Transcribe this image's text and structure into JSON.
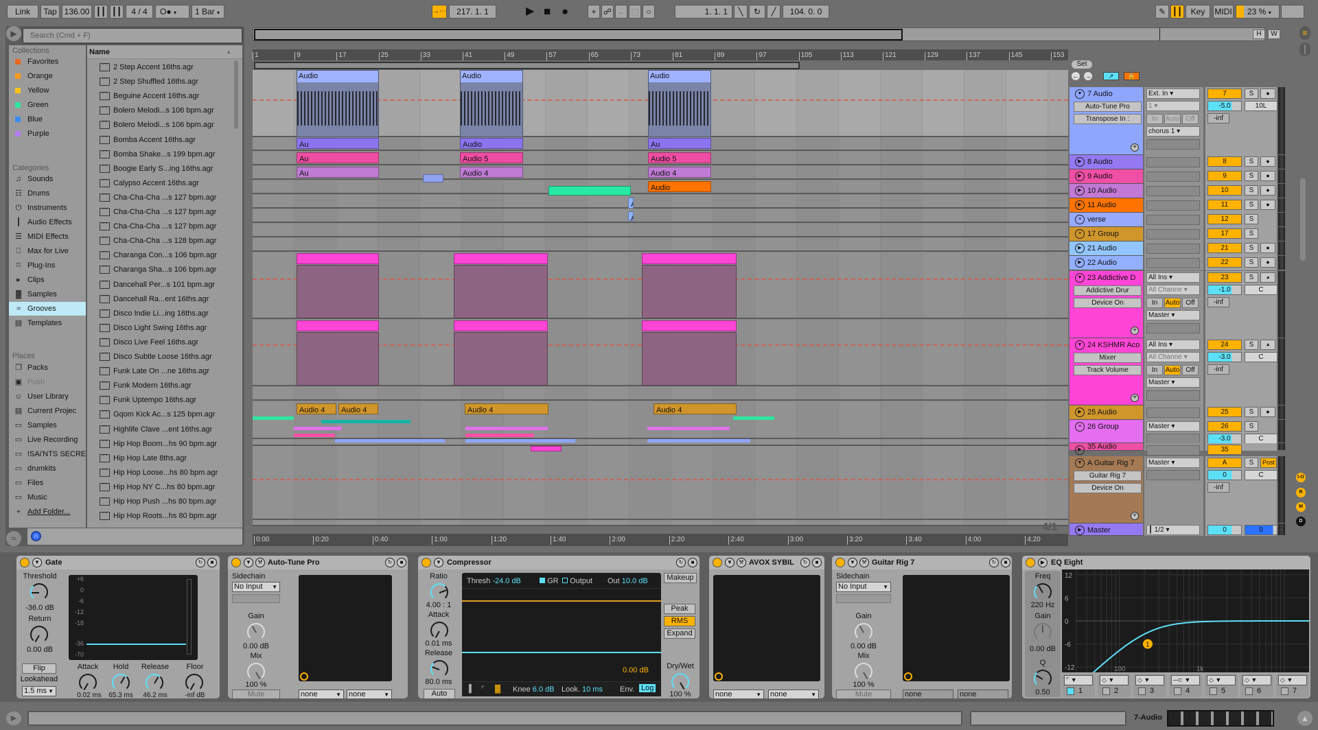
{
  "toolbar": {
    "link": "Link",
    "tap": "Tap",
    "tempo": "136.00",
    "time_sig": "4 / 4",
    "metronome": "O●",
    "quantize": "1 Bar",
    "follow_icon": "→⋯",
    "position": "217.  1.  1",
    "loop_start": "1.  1.  1",
    "loop_length": "104.  0.  0",
    "key": "Key",
    "midi": "MIDI",
    "cpu": "23 %"
  },
  "browser": {
    "search_placeholder": "Search (Cmd + F)",
    "collections_title": "Collections",
    "collections": [
      {
        "label": "Favorites",
        "color": "#e8681e"
      },
      {
        "label": "Orange",
        "color": "#ff9a1c"
      },
      {
        "label": "Yellow",
        "color": "#ffc21a"
      },
      {
        "label": "Green",
        "color": "#2fe6a0"
      },
      {
        "label": "Blue",
        "color": "#3b8cf5"
      },
      {
        "label": "Purple",
        "color": "#b47cf0"
      }
    ],
    "categories_title": "Categories",
    "categories": [
      {
        "label": "Sounds",
        "icon": "♫"
      },
      {
        "label": "Drums",
        "icon": "☷"
      },
      {
        "label": "Instruments",
        "icon": "⏻"
      },
      {
        "label": "Audio Effects",
        "icon": "┃"
      },
      {
        "label": "MIDI Effects",
        "icon": "☰"
      },
      {
        "label": "Max for Live",
        "icon": "⎕"
      },
      {
        "label": "Plug-Ins",
        "icon": "⌑"
      },
      {
        "label": "Clips",
        "icon": "▸"
      },
      {
        "label": "Samples",
        "icon": "▓"
      },
      {
        "label": "Grooves",
        "icon": "≈",
        "selected": true
      },
      {
        "label": "Templates",
        "icon": "▤"
      }
    ],
    "places_title": "Places",
    "places": [
      {
        "label": "Packs",
        "icon": "❐"
      },
      {
        "label": "Push",
        "icon": "▣",
        "disabled": true
      },
      {
        "label": "User Library",
        "icon": "☺"
      },
      {
        "label": "Current Projec",
        "icon": "▤"
      },
      {
        "label": "Samples",
        "icon": "▭"
      },
      {
        "label": "Live Recording",
        "icon": "▭"
      },
      {
        "label": "!SAi'NTS SECRE",
        "icon": "▭"
      },
      {
        "label": "drumkits",
        "icon": "▭"
      },
      {
        "label": "Files",
        "icon": "▭"
      },
      {
        "label": "Music",
        "icon": "▭"
      },
      {
        "label": "Add Folder...",
        "icon": "+"
      }
    ],
    "name_header": "Name",
    "files": [
      "2 Step Accent 16ths.agr",
      "2 Step Shuffled 16ths.agr",
      "Beguine Accent 16ths.agr",
      "Bolero Melodi...s 106 bpm.agr",
      "Bolero Melodi...s 106 bpm.agr",
      "Bomba Accent 16ths.agr",
      "Bomba Shake...s 199 bpm.agr",
      "Boogie Early S...ing 16ths.agr",
      "Calypso Accent 16ths.agr",
      "Cha-Cha-Cha ...s 127 bpm.agr",
      "Cha-Cha-Cha ...s 127 bpm.agr",
      "Cha-Cha-Cha ...s 127 bpm.agr",
      "Cha-Cha-Cha ...s 128 bpm.agr",
      "Charanga Con...s 106 bpm.agr",
      "Charanga Sha...s 106 bpm.agr",
      "Dancehall Per...s 101 bpm.agr",
      "Dancehall Ra...ent 16ths.agr",
      "Disco Indie Li...ing 16ths.agr",
      "Disco Light Swing 16ths.agr",
      "Disco Live Feel 16ths.agr",
      "Disco Subtle Loose 16ths.agr",
      "Funk Late On ...ne 16ths.agr",
      "Funk Modern 16ths.agr",
      "Funk Uptempo 16ths.agr",
      "Gqom Kick Ac...s 125 bpm.agr",
      "Highlife Clave ...ent 16ths.agr",
      "Hip Hop Boom...hs 90 bpm.agr",
      "Hip Hop Late 8ths.agr",
      "Hip Hop Loose...hs 80 bpm.agr",
      "Hip Hop NY C...hs 80 bpm.agr",
      "Hip Hop Push ...hs 80 bpm.agr",
      "Hip Hop Roots...hs 80 bpm.agr"
    ]
  },
  "arrangement": {
    "bar_ticks": [
      "1",
      "9",
      "17",
      "25",
      "33",
      "41",
      "49",
      "57",
      "65",
      "73",
      "81",
      "89",
      "97",
      "105",
      "113",
      "121",
      "129",
      "137",
      "145",
      "153"
    ],
    "time_ticks": [
      "0:00",
      "0:20",
      "0:40",
      "1:00",
      "1:20",
      "1:40",
      "2:00",
      "2:20",
      "2:40",
      "3:00",
      "3:20",
      "3:40",
      "4:00",
      "4:20"
    ],
    "zoom_readout": "4/1",
    "overview_h": "H",
    "overview_w": "W",
    "clip_labels": {
      "audio": "Audio",
      "audio5": "Audio 5",
      "audio4": "Audio 4",
      "au": "Au",
      "a": "A"
    }
  },
  "tracks": {
    "set_label": "Set",
    "list": [
      {
        "name": "7 Audio",
        "color": "#8fa6ff",
        "num": "7",
        "input": "Ext. In",
        "channel": "1",
        "output": "chorus 1",
        "device": "Auto-Tune Pro",
        "param": "Transpose In :",
        "vol": "-5.0",
        "pan": "10L",
        "inf": "-inf",
        "monitor": [
          "In",
          "Auto",
          "Off"
        ]
      },
      {
        "name": "8 Audio",
        "color": "#9579f2",
        "num": "8"
      },
      {
        "name": "9 Audio",
        "color": "#f04fa6",
        "num": "9"
      },
      {
        "name": "10 Audio",
        "color": "#c279d6",
        "num": "10"
      },
      {
        "name": "11 Audio",
        "color": "#ff7300",
        "num": "11"
      },
      {
        "name": "verse",
        "color": "#98aaff",
        "num": "12"
      },
      {
        "name": "17 Group",
        "color": "#d0962b",
        "num": "17"
      },
      {
        "name": "21 Audio",
        "color": "#93c6ff",
        "num": "21"
      },
      {
        "name": "22 Audio",
        "color": "#93b0ff",
        "num": "22"
      },
      {
        "name": "23 Addictive D",
        "color": "#ff45d6",
        "num": "23",
        "input": "All Ins",
        "channel": "All Channe",
        "output": "Master",
        "device": "Addictive Drur",
        "param": "Device On",
        "vol": "-1.0",
        "pan": "C",
        "inf": "-inf",
        "monitor": [
          "In",
          "Auto",
          "Off"
        ]
      },
      {
        "name": "24 KSHMR Aco",
        "color": "#ff45d6",
        "num": "24",
        "input": "All Ins",
        "channel": "All Channe",
        "output": "Master",
        "device": "Mixer",
        "param": "Track Volume",
        "vol": "-3.0",
        "pan": "C",
        "inf": "-inf",
        "monitor": [
          "In",
          "Auto",
          "Off"
        ]
      },
      {
        "name": "25 Audio",
        "color": "#d0962b",
        "num": "25"
      },
      {
        "name": "26 Group",
        "color": "#e46df0",
        "num": "26",
        "output": "Master",
        "vol": "-3.0",
        "pan": "C"
      },
      {
        "name": "35 Audio",
        "color": "#f04fa6",
        "num": "35"
      },
      {
        "name": "A Guitar Rig 7",
        "color": "#a47a55",
        "num": "A",
        "output": "Master",
        "device": "Guitar Rig 7",
        "param": "Device On",
        "vol": "0",
        "pan": "C",
        "inf": "-inf",
        "post": "Post"
      },
      {
        "name": "Master",
        "color": "#9579f2",
        "num": "0",
        "output": "1/2",
        "vol": "0"
      }
    ],
    "solo": "S",
    "right_icons": [
      "I-O",
      "R",
      "M",
      "D"
    ]
  },
  "devices": {
    "gate": {
      "title": "Gate",
      "threshold_label": "Threshold",
      "threshold": "-36.0 dB",
      "return_label": "Return",
      "return": "0.00 dB",
      "flip": "Flip",
      "lookahead_label": "Lookahead",
      "lookahead": "1.5 ms",
      "attack_label": "Attack",
      "attack": "0.02 ms",
      "hold_label": "Hold",
      "hold": "65.3 ms",
      "release_label": "Release",
      "release": "46.2 ms",
      "floor_label": "Floor",
      "floor": "-inf dB",
      "scale": [
        "+6",
        "0",
        "-6",
        "-12",
        "-18",
        "-36",
        "-70"
      ]
    },
    "autotune": {
      "title": "Auto-Tune Pro",
      "sidechain": "Sidechain",
      "sidechain_input": "No Input",
      "gain_label": "Gain",
      "gain": "0.00 dB",
      "mix_label": "Mix",
      "mix": "100 %",
      "mute": "Mute",
      "macro1": "none",
      "macro2": "none"
    },
    "compressor": {
      "title": "Compressor",
      "ratio_label": "Ratio",
      "ratio": "4.00 : 1",
      "attack_label": "Attack",
      "attack": "0.01 ms",
      "release_label": "Release",
      "release": "80.0 ms",
      "auto": "Auto",
      "thresh_label": "Thresh",
      "thresh": "-24.0 dB",
      "gr": "GR",
      "output": "Output",
      "out_label": "Out",
      "out": "10.0 dB",
      "readout": "0.00 dB",
      "knee_label": "Knee",
      "knee": "6.0 dB",
      "look_label": "Look.",
      "look": "10 ms",
      "env_label": "Env.",
      "env": "Log",
      "makeup": "Makeup",
      "peak": "Peak",
      "rms": "RMS",
      "expand": "Expand",
      "drywet_label": "Dry/Wet",
      "drywet": "100 %"
    },
    "avox": {
      "title": "AVOX SYBIL",
      "macro1": "none",
      "macro2": "none"
    },
    "guitarrig": {
      "title": "Guitar Rig 7",
      "sidechain": "Sidechain",
      "sidechain_input": "No Input",
      "gain_label": "Gain",
      "gain": "0.00 dB",
      "mix_label": "Mix",
      "mix": "100 %",
      "mute": "Mute",
      "macro1": "none",
      "macro2": "none"
    },
    "eq": {
      "title": "EQ Eight",
      "freq_label": "Freq",
      "freq": "220 Hz",
      "gain_label": "Gain",
      "gain": "0.00 dB",
      "q_label": "Q",
      "q": "0.50",
      "db_scale": [
        "12",
        "6",
        "0",
        "-6",
        "-12"
      ],
      "freq_scale": [
        "100",
        "1k"
      ],
      "band_marker": "1",
      "bands": [
        "1",
        "2",
        "3",
        "4",
        "5",
        "6",
        "7"
      ]
    }
  },
  "statusbar": {
    "selected_track": "7-Audio"
  },
  "colors": {
    "accent": "#ffb300",
    "cyan": "#5ce0f7",
    "magenta": "#ff45d6"
  }
}
